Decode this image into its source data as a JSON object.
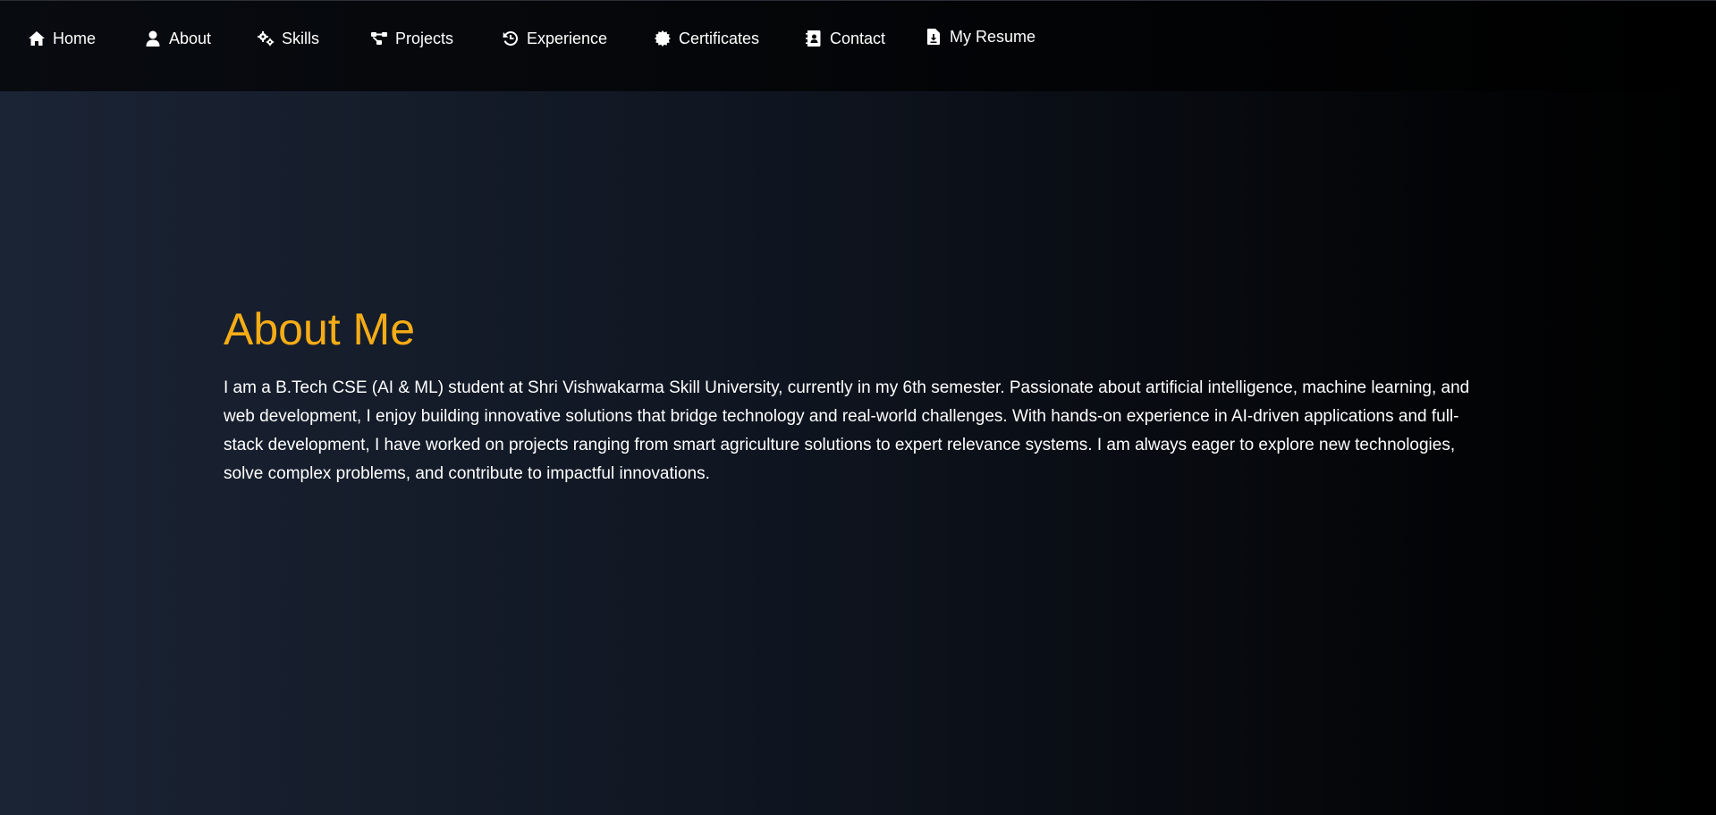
{
  "nav": {
    "items": [
      {
        "label": "Home",
        "icon": "home-icon"
      },
      {
        "label": "About",
        "icon": "user-icon"
      },
      {
        "label": "Skills",
        "icon": "gears-icon"
      },
      {
        "label": "Projects",
        "icon": "diagram-icon"
      },
      {
        "label": "Experience",
        "icon": "history-icon"
      },
      {
        "label": "Certificates",
        "icon": "certificate-icon"
      },
      {
        "label": "Contact",
        "icon": "address-book-icon"
      },
      {
        "label": "My Resume",
        "icon": "file-download-icon"
      }
    ]
  },
  "about": {
    "heading": "About Me",
    "body": "I am a B.Tech CSE (AI & ML) student at Shri Vishwakarma Skill University, currently in my 6th semester. Passionate about artificial intelligence, machine learning, and web development, I enjoy building innovative solutions that bridge technology and real-world challenges. With hands-on experience in AI-driven applications and full-stack development, I have worked on projects ranging from smart agriculture solutions to expert relevance systems. I am always eager to explore new technologies, solve complex problems, and contribute to impactful innovations."
  },
  "colors": {
    "accent": "#f5ac16",
    "text": "#ffffff",
    "background": "#0f1520"
  }
}
